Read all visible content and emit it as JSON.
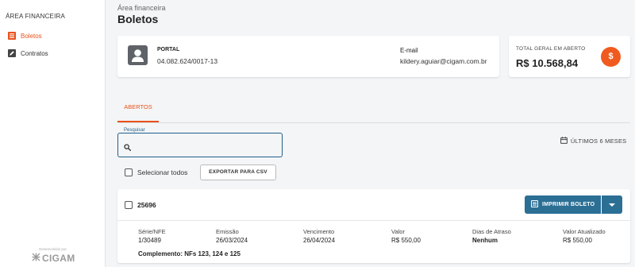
{
  "sidebar": {
    "title": "ÁREA FINANCEIRA",
    "items": [
      {
        "label": "Boletos",
        "icon": "list-icon",
        "active": true
      },
      {
        "label": "Contratos",
        "icon": "edit-icon",
        "active": false
      }
    ],
    "powered_by": "Desenvolvido por",
    "logo_text": "CIGAM"
  },
  "header": {
    "breadcrumb": "Área financeira",
    "title": "Boletos"
  },
  "info_card": {
    "portal_label": "PORTAL",
    "cnpj": "04.082.624/0017-13",
    "email_label": "E-mail",
    "email": "kildery.aguiar@cigam.com.br"
  },
  "total_card": {
    "label": "TOTAL GERAL EM ABERTO",
    "value": "R$ 10.568,84",
    "icon": "$"
  },
  "tabs": [
    {
      "label": "ABERTOS",
      "active": true
    }
  ],
  "search": {
    "legend": "Pesquisar",
    "value": "",
    "placeholder": ""
  },
  "period_filter": "ÚLTIMOS 6 MESES",
  "select_all_label": "Selecionar todos",
  "export_label": "EXPORTAR PARA CSV",
  "boleto": {
    "number": "25696",
    "print_label": "IMPRIMIR BOLETO",
    "columns": [
      {
        "label": "Série/NFE",
        "value": "1/30489"
      },
      {
        "label": "Emissão",
        "value": "26/03/2024"
      },
      {
        "label": "Vencimento",
        "value": "26/04/2024"
      },
      {
        "label": "Valor",
        "value": "R$ 550,00"
      },
      {
        "label": "Dias de Atraso",
        "value": "Nenhum"
      },
      {
        "label": "Valor Atualizado",
        "value": "R$ 550,00"
      }
    ],
    "complement": "Complemento: NFs 123, 124 e 125"
  },
  "colors": {
    "accent": "#e8521c",
    "primary_button": "#2b6f95",
    "total_icon": "#f05a1e"
  }
}
